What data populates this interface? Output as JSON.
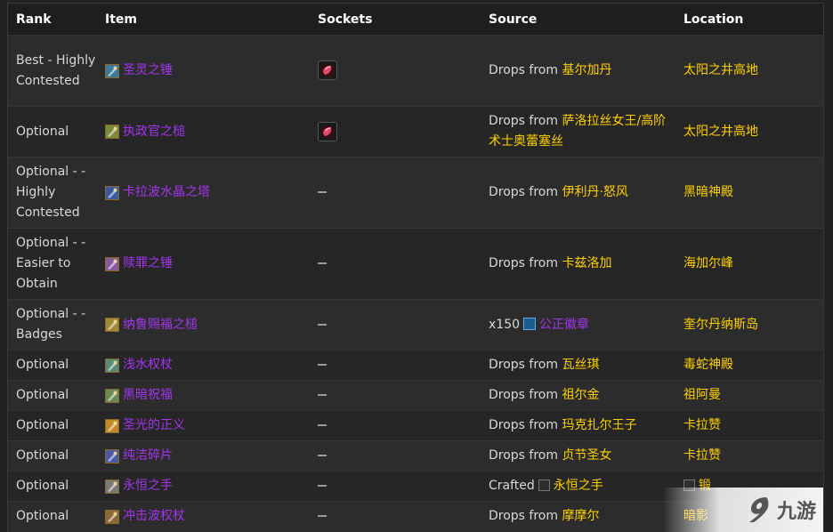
{
  "headers": {
    "rank": "Rank",
    "item": "Item",
    "sockets": "Sockets",
    "source": "Source",
    "location": "Location"
  },
  "rows": [
    {
      "rank": "Best - Highly Contested",
      "item": "圣灵之锤",
      "icon_color": "#3a7a9a",
      "socket": "red-gem",
      "source_prefix": "Drops from",
      "source_name": "基尔加丹",
      "location": "太阳之井高地"
    },
    {
      "rank": "Optional",
      "item": "执政官之槌",
      "icon_color": "#7a8a3a",
      "socket": "red-gem",
      "source_prefix": "Drops from",
      "source_name": "萨洛拉丝女王/高阶术士奥蕾塞丝",
      "location": "太阳之井高地"
    },
    {
      "rank": "Optional - - Highly Contested",
      "item": "卡拉波水晶之塔",
      "icon_color": "#3a5aa0",
      "socket": "none",
      "source_prefix": "Drops from",
      "source_name": "伊利丹·怒风",
      "location": "黑暗神殿"
    },
    {
      "rank": "Optional - - Easier to Obtain",
      "item": "赎罪之锤",
      "icon_color": "#8a5aa0",
      "socket": "none",
      "source_prefix": "Drops from",
      "source_name": "卡兹洛加",
      "location": "海加尔峰"
    },
    {
      "rank": "Optional - - Badges",
      "item": "纳鲁赐福之槌",
      "icon_color": "#a08a3a",
      "socket": "none",
      "source_prefix": "x150",
      "source_name": "公正徽章",
      "location": "奎尔丹纳斯岛"
    },
    {
      "rank": "Optional",
      "item": "浅水权杖",
      "icon_color": "#5a8a7a",
      "socket": "none",
      "source_prefix": "Drops from",
      "source_name": "瓦丝琪",
      "location": "毒蛇神殿"
    },
    {
      "rank": "Optional",
      "item": "黑暗祝福",
      "icon_color": "#6a8a5a",
      "socket": "none",
      "source_prefix": "Drops from",
      "source_name": "祖尔金",
      "location": "祖阿曼"
    },
    {
      "rank": "Optional",
      "item": "圣光的正义",
      "icon_color": "#c08a2a",
      "socket": "none",
      "source_prefix": "Drops from",
      "source_name": "玛克扎尔王子",
      "location": "卡拉赞"
    },
    {
      "rank": "Optional",
      "item": "纯洁碎片",
      "icon_color": "#4a5aa8",
      "socket": "none",
      "source_prefix": "Drops from",
      "source_name": "贞节圣女",
      "location": "卡拉赞"
    },
    {
      "rank": "Optional",
      "item": "永恒之手",
      "icon_color": "#7a7a7a",
      "socket": "none",
      "source_prefix": "Crafted",
      "source_name": "永恒之手",
      "location": "锻"
    },
    {
      "rank": "Optional",
      "item": "冲击波权杖",
      "icon_color": "#8a6a3a",
      "socket": "none",
      "source_prefix": "Drops from",
      "source_name": "摩摩尔",
      "location": "暗影"
    }
  ],
  "watermark": {
    "text": "九游"
  }
}
